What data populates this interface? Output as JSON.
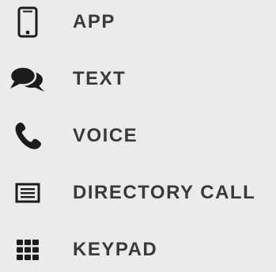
{
  "menu": {
    "items": [
      {
        "label": "APP",
        "icon": "smartphone-icon"
      },
      {
        "label": "TEXT",
        "icon": "chat-bubbles-icon"
      },
      {
        "label": "VOICE",
        "icon": "phone-icon"
      },
      {
        "label": "DIRECTORY CALL",
        "icon": "directory-list-icon"
      },
      {
        "label": "KEYPAD",
        "icon": "keypad-icon"
      }
    ]
  },
  "colors": {
    "background": "#ebebeb",
    "foreground": "#1c1c1c",
    "text": "#3a3a3a"
  }
}
